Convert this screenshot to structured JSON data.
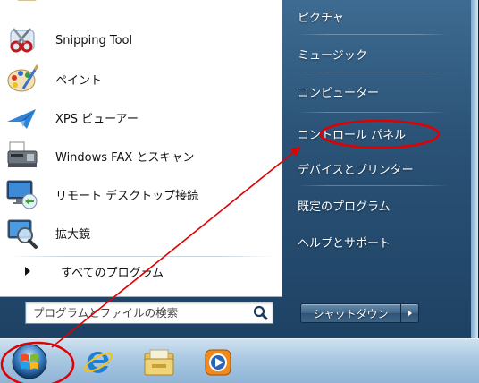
{
  "programs": [
    {
      "label": "Snipping Tool",
      "icon": "scissors-icon"
    },
    {
      "label": "ペイント",
      "icon": "paint-palette-icon"
    },
    {
      "label": "XPS ビューアー",
      "icon": "xps-viewer-icon"
    },
    {
      "label": "Windows FAX とスキャン",
      "icon": "fax-scanner-icon"
    },
    {
      "label": "リモート デスクトップ接続",
      "icon": "remote-desktop-icon"
    },
    {
      "label": "拡大鏡",
      "icon": "magnifier-icon"
    }
  ],
  "all_programs_label": "すべてのプログラム",
  "search": {
    "placeholder": "プログラムとファイルの検索",
    "value": ""
  },
  "right_items": [
    {
      "label": "ピクチャ"
    },
    {
      "label": "ミュージック"
    },
    {
      "label": "コンピューター"
    },
    {
      "label": "コントロール パネル"
    },
    {
      "label": "デバイスとプリンター"
    },
    {
      "label": "既定のプログラム"
    },
    {
      "label": "ヘルプとサポート"
    }
  ],
  "shutdown_label": "シャットダウン",
  "taskbar": [
    {
      "icon": "windows-start-orb-icon"
    },
    {
      "icon": "internet-explorer-icon"
    },
    {
      "icon": "file-explorer-icon"
    },
    {
      "icon": "media-player-icon"
    }
  ],
  "colors": {
    "annotation": "#e00000",
    "menu_blue": "#2b5377",
    "taskbar": "#a9c8e2"
  }
}
